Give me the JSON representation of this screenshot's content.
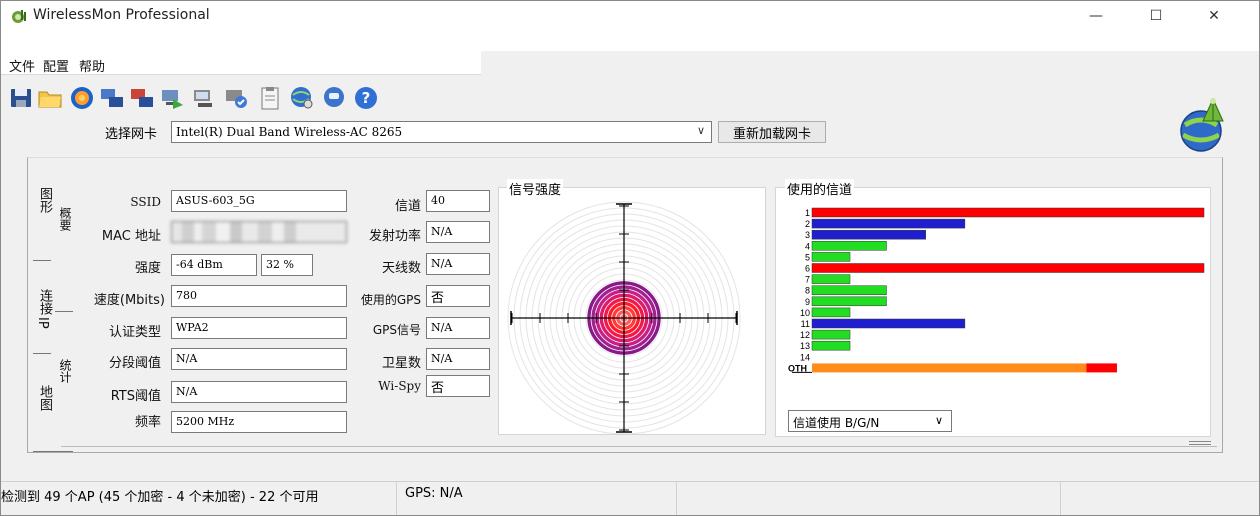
{
  "window": {
    "title": "WirelessMon Professional",
    "controls": {
      "minimize": "—",
      "maximize": "☐",
      "close": "✕"
    }
  },
  "menu": [
    "文件",
    "配置",
    "帮助"
  ],
  "toolbar": {
    "icons": [
      "save-icon",
      "open-folder-icon",
      "record-icon",
      "compare-icon",
      "compare-red-icon",
      "network-icon",
      "network-config-icon",
      "network-check-icon",
      "clipboard-icon",
      "globe-search-icon",
      "chat-icon",
      "help-icon"
    ]
  },
  "nic": {
    "label": "选择网卡",
    "selected": "Intel(R) Dual Band Wireless-AC 8265",
    "reload_label": "重新加载网卡"
  },
  "tabs": {
    "graph": "图形",
    "summary": "概要",
    "connect": "连接",
    "ip": "IP",
    "stats": "统计",
    "map": "地图"
  },
  "fields": {
    "ssid_label": "SSID",
    "ssid": "ASUS-603_5G",
    "mac_label": "MAC 地址",
    "strength_label": "强度",
    "strength_dbm": "-64 dBm",
    "strength_pct": "32 %",
    "speed_label": "速度(Mbits)",
    "speed": "780",
    "auth_label": "认证类型",
    "auth": "WPA2",
    "frag_label": "分段阈值",
    "frag": "N/A",
    "rts_label": "RTS阈值",
    "rts": "N/A",
    "freq_label": "频率",
    "freq": "5200 MHz",
    "channel_label": "信道",
    "channel": "40",
    "txpower_label": "发射功率",
    "txpower": "N/A",
    "antennas_label": "天线数",
    "antennas": "N/A",
    "gps_used_label": "使用的GPS",
    "gps_used": "否",
    "gps_signal_label": "GPS信号",
    "gps_signal": "N/A",
    "satellites_label": "卫星数",
    "satellites": "N/A",
    "wispy_label": "Wi-Spy",
    "wispy": "否"
  },
  "signal": {
    "title": "信号强度",
    "strength_percent": 32
  },
  "channels": {
    "title": "使用的信道",
    "filter": "信道使用 B/G/N",
    "colors": {
      "red": "#ff0000",
      "blue": "#1f1fcf",
      "green": "#22dd22",
      "orange": "#ff8c1a"
    },
    "rows": [
      {
        "label": "1",
        "value": 1.0,
        "color": "red"
      },
      {
        "label": "2",
        "value": 0.39,
        "color": "blue"
      },
      {
        "label": "3",
        "value": 0.29,
        "color": "blue"
      },
      {
        "label": "4",
        "value": 0.19,
        "color": "green"
      },
      {
        "label": "5",
        "value": 0.097,
        "color": "green"
      },
      {
        "label": "6",
        "value": 1.0,
        "color": "red"
      },
      {
        "label": "7",
        "value": 0.097,
        "color": "green"
      },
      {
        "label": "8",
        "value": 0.19,
        "color": "green"
      },
      {
        "label": "9",
        "value": 0.19,
        "color": "green"
      },
      {
        "label": "10",
        "value": 0.097,
        "color": "green"
      },
      {
        "label": "11",
        "value": 0.39,
        "color": "blue"
      },
      {
        "label": "12",
        "value": 0.097,
        "color": "green"
      },
      {
        "label": "13",
        "value": 0.097,
        "color": "green"
      },
      {
        "label": "14",
        "value": 0,
        "color": "green"
      }
    ],
    "oth": {
      "label": "OTH",
      "orange": 0.7,
      "red": 0.078
    }
  },
  "status": {
    "ap_summary": "检测到 49 个AP (45 个加密 - 4 个未加密) - 22 个可用",
    "gps": "GPS: N/A"
  }
}
